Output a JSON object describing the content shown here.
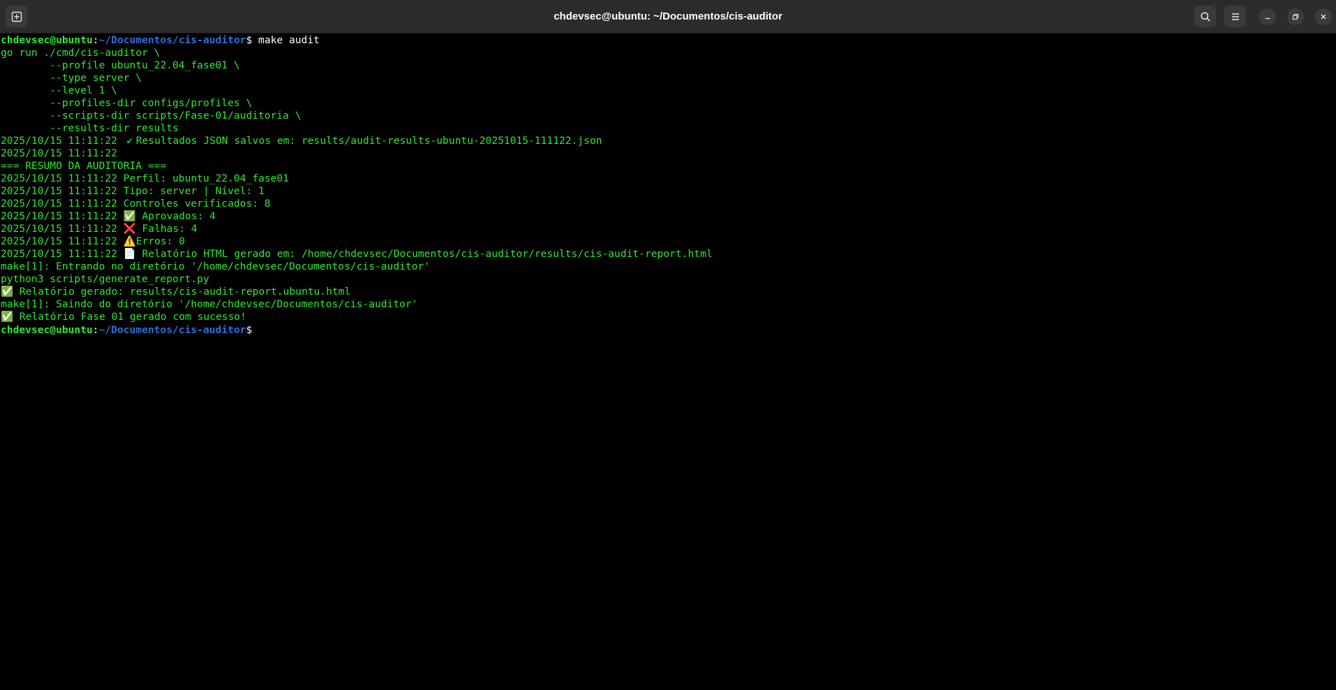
{
  "window": {
    "title": "chdevsec@ubuntu: ~/Documentos/cis-auditor"
  },
  "prompt": {
    "user_host": "chdevsec@ubuntu",
    "colon": ":",
    "path": "~/Documentos/cis-auditor",
    "dollar": "$"
  },
  "icons": {
    "new_tab": "new-tab-icon",
    "search": "search-icon",
    "menu": "hamburger-menu-icon",
    "minimize": "minimize-icon",
    "maximize": "restore-icon",
    "close": "close-icon"
  },
  "colors": {
    "terminal_bg": "#000000",
    "terminal_text": "#33e633",
    "prompt_path": "#2f6fd6",
    "titlebar_bg": "#2b2b2b"
  },
  "lines": [
    {
      "kind": "prompt",
      "command": " make audit"
    },
    {
      "kind": "out",
      "text": "go run ./cmd/cis-auditor \\"
    },
    {
      "kind": "out",
      "text": "        --profile ubuntu_22.04_fase01 \\"
    },
    {
      "kind": "out",
      "text": "        --type server \\"
    },
    {
      "kind": "out",
      "text": "        --level 1 \\"
    },
    {
      "kind": "out",
      "text": "        --profiles-dir configs/profiles \\"
    },
    {
      "kind": "out",
      "text": "        --scripts-dir scripts/Fase-01/auditoria \\"
    },
    {
      "kind": "out",
      "text": "        --results-dir results"
    },
    {
      "kind": "emoji",
      "prefix": "2025/10/15 11:11:22 ",
      "emoji": "✔",
      "emoji_class": "e-check",
      "text": "Resultados JSON salvos em: results/audit-results-ubuntu-20251015-111122.json"
    },
    {
      "kind": "out",
      "text": "2025/10/15 11:11:22"
    },
    {
      "kind": "out",
      "text": "=== RESUMO DA AUDITORIA ==="
    },
    {
      "kind": "out",
      "text": "2025/10/15 11:11:22 Perfil: ubuntu_22.04_fase01"
    },
    {
      "kind": "out",
      "text": "2025/10/15 11:11:22 Tipo: server | Nível: 1"
    },
    {
      "kind": "out",
      "text": "2025/10/15 11:11:22 Controles verificados: 8"
    },
    {
      "kind": "emoji",
      "prefix": "2025/10/15 11:11:22 ",
      "emoji": "✅",
      "emoji_class": "e-check",
      "text": " Aprovados: 4"
    },
    {
      "kind": "emoji",
      "prefix": "2025/10/15 11:11:22 ",
      "emoji": "❌",
      "emoji_class": "e-cross",
      "text": " Falhas: 4"
    },
    {
      "kind": "emoji",
      "prefix": "2025/10/15 11:11:22 ",
      "emoji": "⚠️",
      "emoji_class": "e-warn",
      "text": "Erros: 0"
    },
    {
      "kind": "emoji",
      "prefix": "2025/10/15 11:11:22 ",
      "emoji": "📄",
      "emoji_class": "e-doc",
      "text": " Relatório HTML gerado em: /home/chdevsec/Documentos/cis-auditor/results/cis-audit-report.html"
    },
    {
      "kind": "out",
      "text": "make[1]: Entrando no diretório '/home/chdevsec/Documentos/cis-auditor'"
    },
    {
      "kind": "out",
      "text": "python3 scripts/generate_report.py"
    },
    {
      "kind": "emoji",
      "prefix": "",
      "emoji": "✅",
      "emoji_class": "e-check",
      "text": " Relatório gerado: results/cis-audit-report.ubuntu.html"
    },
    {
      "kind": "out",
      "text": "make[1]: Saindo do diretório '/home/chdevsec/Documentos/cis-auditor'"
    },
    {
      "kind": "emoji",
      "prefix": "",
      "emoji": "✅",
      "emoji_class": "e-check",
      "text": " Relatório Fase 01 gerado com sucesso!"
    },
    {
      "kind": "prompt",
      "command": ""
    }
  ]
}
